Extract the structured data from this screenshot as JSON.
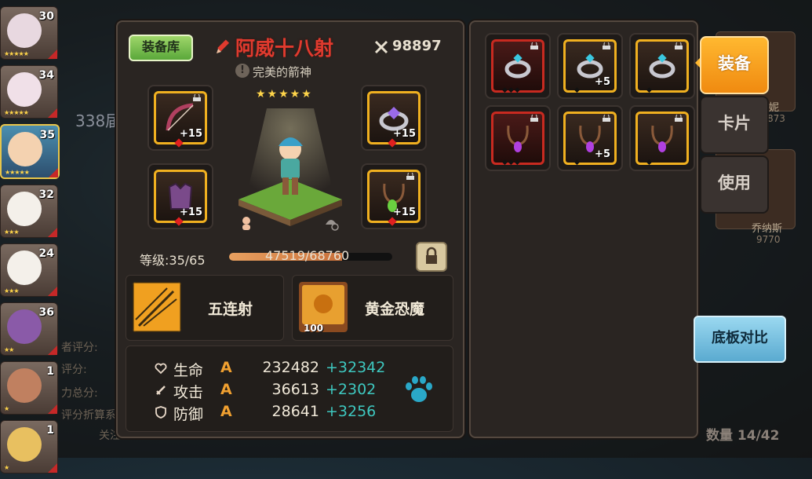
{
  "heroes": [
    {
      "level": "30",
      "stars": "★★★★★",
      "face": "#e8d8e0"
    },
    {
      "level": "34",
      "stars": "★★★★★",
      "face": "#f0e0e8"
    },
    {
      "level": "35",
      "stars": "★★★★★",
      "face": "#f4d2b0",
      "selected": true
    },
    {
      "level": "32",
      "stars": "★★★",
      "face": "#f4f0ea"
    },
    {
      "level": "24",
      "stars": "★★★",
      "face": "#f4f0ea"
    },
    {
      "level": "36",
      "stars": "★★",
      "face": "#8a5aa8"
    },
    {
      "level": "1",
      "stars": "★",
      "face": "#c08060"
    },
    {
      "level": "1",
      "stars": "★",
      "face": "#e8c060"
    }
  ],
  "background": {
    "rank_text": "338届",
    "score_labels": [
      "者评分:",
      "评分:",
      "力总分:",
      "评分折算系"
    ],
    "follow_text": "关注",
    "right_names": [
      {
        "name": "乔纳斯",
        "value": "9770"
      },
      {
        "name": "妮",
        "value": "873"
      }
    ]
  },
  "main": {
    "library_button": "装备库",
    "hero_name": "阿威十八射",
    "hero_title": "完美的箭神",
    "title_icon_char": "!",
    "hero_stars": "★★★★★",
    "power": "98897",
    "equipment": [
      {
        "slot": "weapon",
        "icon": "bow-icon",
        "plus": "+15",
        "locked": true
      },
      {
        "slot": "ring",
        "icon": "ring-icon",
        "plus": "+15",
        "locked": false
      },
      {
        "slot": "armor",
        "icon": "armor-icon",
        "plus": "+15",
        "locked": false
      },
      {
        "slot": "necklace",
        "icon": "necklace-icon",
        "plus": "+15",
        "locked": true
      }
    ],
    "level_label": "等级:35/65",
    "xp_text": "47519/68760",
    "xp_fraction": 0.691,
    "skill_name": "五连射",
    "card_name": "黄金恐魔",
    "card_count": "100",
    "stats": [
      {
        "name": "生命",
        "grade": "A",
        "value": "232482",
        "bonus": "+32342",
        "icon": "heart-icon"
      },
      {
        "name": "攻击",
        "grade": "A",
        "value": "36613",
        "bonus": "+2302",
        "icon": "sword-icon"
      },
      {
        "name": "防御",
        "grade": "A",
        "value": "28641",
        "bonus": "+3256",
        "icon": "shield-icon"
      }
    ]
  },
  "inventory": {
    "items": [
      {
        "icon": "ring-icon",
        "plus": "",
        "rarity": "red",
        "dots": "◆◆◆"
      },
      {
        "icon": "ring-icon",
        "plus": "+5",
        "rarity": "gold",
        "dots": "◆"
      },
      {
        "icon": "ring-icon",
        "plus": "",
        "rarity": "gold",
        "dots": "◆"
      },
      {
        "icon": "necklace-icon",
        "plus": "",
        "rarity": "red",
        "dots": "◆◆◆"
      },
      {
        "icon": "necklace-icon",
        "plus": "+5",
        "rarity": "gold",
        "dots": "◆"
      },
      {
        "icon": "necklace-icon",
        "plus": "",
        "rarity": "gold",
        "dots": "◆"
      }
    ],
    "count": "数量 14/42"
  },
  "tabs": {
    "equip": "装备",
    "cards": "卡片",
    "use": "使用"
  },
  "compare_button": "底板对比",
  "colors": {
    "accent": "#f0b020",
    "grade": "#f0a030",
    "bonus": "#3ec8c0",
    "name": "#e03a2e"
  }
}
